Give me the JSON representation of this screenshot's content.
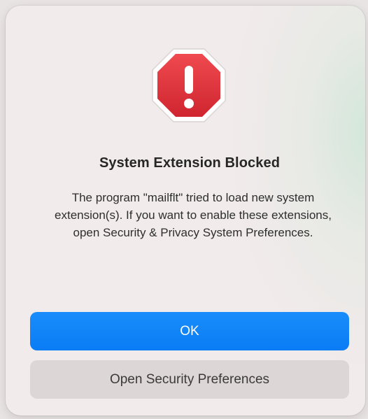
{
  "dialog": {
    "icon": "stop-alert-icon",
    "title": "System Extension Blocked",
    "message": "The program \"mailflt\" tried to load new system extension(s). If you want to enable these extensions, open Security & Privacy System Preferences.",
    "buttons": {
      "ok_label": "OK",
      "open_prefs_label": "Open Security Preferences"
    },
    "colors": {
      "icon_red": "#e0323a",
      "ok_blue": "#0a7cf5",
      "secondary_button": "#ddd6d6"
    }
  }
}
